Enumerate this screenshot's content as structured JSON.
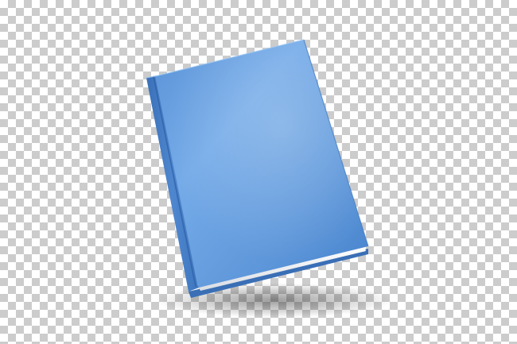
{
  "image": {
    "subject": "blue-hardcover-book",
    "background": "transparency-checkerboard",
    "colors": {
      "checker_light": "#ffffff",
      "checker_dark": "#cccccc",
      "cover_light": "#7fb2ea",
      "cover_mid": "#5e97da",
      "cover_dark": "#3f78bf",
      "spine_dark": "#2f63a8",
      "pages": "#f2f2f2",
      "shadow": "#000000"
    }
  }
}
